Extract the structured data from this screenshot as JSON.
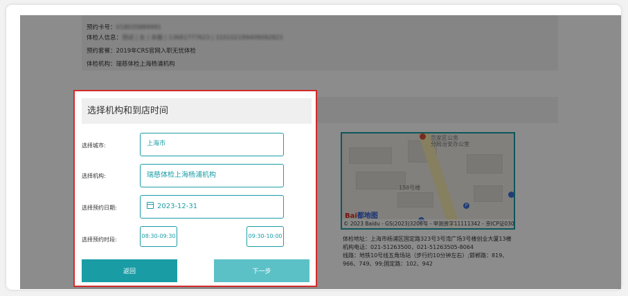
{
  "booking": {
    "card_label": "预约卡号：",
    "card_value": "V18035889991",
    "person_label": "体检人信息：",
    "person_value": "测试 | 女 | 未婚 | 13681777623 | 310102199409092823",
    "package_label": "预约套餐：",
    "package_value": "2019年CRS官网入职无忧体检",
    "org_label": "体检机构：",
    "org_value": "瑞慈体检上海杨浦机构"
  },
  "map": {
    "label_158": "158号楼",
    "poi_text": "京家区公务\n分局治安办公室",
    "logo_text": "Bai",
    "logo_accent": "都地图",
    "copyright": "© 2023 Baidu - GS(2023)3206号 - 甲测资字11111342 - 京ICP证030"
  },
  "address": {
    "line1": "体检地址：上海市杨浦区国定路323号3号湾广场3号楼创业大厦13楼",
    "line2": "机构电话：021-51263500，021-51263505-8064",
    "line3": "线路：地铁10号线五角场站（步行约10分钟左右）;邯郸路：819、966、749、99;国定路：102、942"
  },
  "modal": {
    "title": "选择机构和到店时间",
    "city_label": "选择城市:",
    "city_value": "上海市",
    "org_label": "选择机构:",
    "org_value": "瑞慈体检上海杨浦机构",
    "date_label": "选择预约日期:",
    "date_value": "2023-12-31",
    "slot_label": "选择预约时段:",
    "slot1": "08:30-09:30",
    "slot2": "09:30-10:00",
    "back_label": "返回",
    "next_label": "下一步"
  },
  "colors": {
    "accent": "#1a9ca5",
    "accent_light": "#5cc1c7",
    "highlight_border": "#d32a2a"
  }
}
